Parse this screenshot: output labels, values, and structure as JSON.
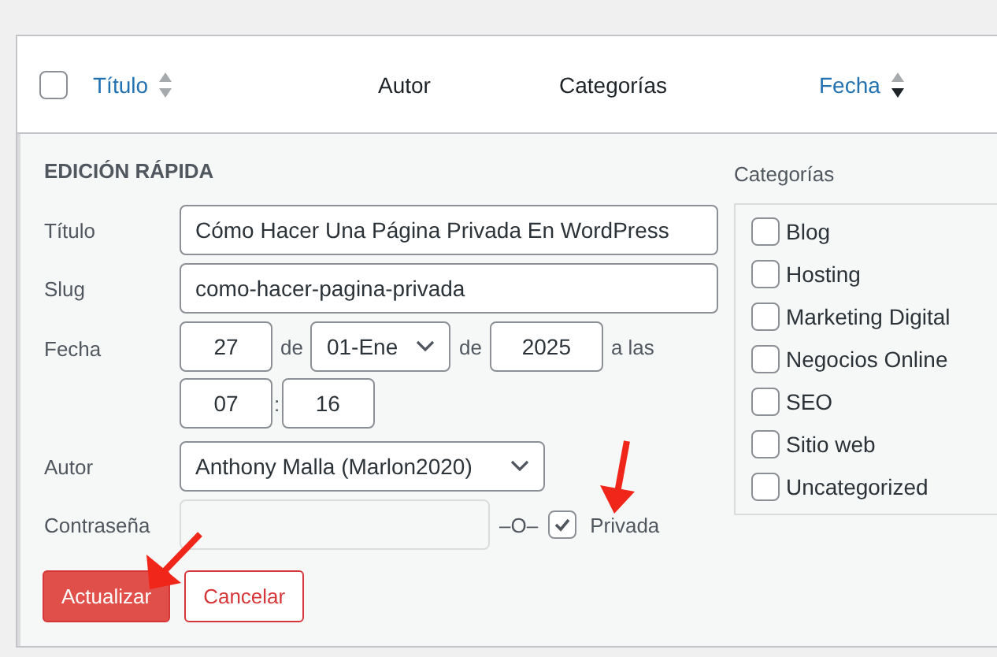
{
  "table": {
    "select_all": {
      "checked": false
    },
    "columns": [
      {
        "label": "Título",
        "kind": "sortable",
        "sorted_descending": false
      },
      {
        "label": "Autor",
        "kind": "plain"
      },
      {
        "label": "Categorías",
        "kind": "plain"
      },
      {
        "label": "Fecha",
        "kind": "sortable",
        "sorted_descending": true
      }
    ]
  },
  "quick_edit": {
    "heading": "EDICIÓN RÁPIDA",
    "title": {
      "label": "Título",
      "value": "Cómo Hacer Una Página Privada En WordPress"
    },
    "slug": {
      "label": "Slug",
      "value": "como-hacer-pagina-privada"
    },
    "date": {
      "label": "Fecha",
      "day": "27",
      "sep_1": "de",
      "month": "01-Ene",
      "sep_2": "de",
      "year": "2025",
      "sep_3": "a las",
      "hour": "07",
      "time_sep": ":",
      "minute": "16"
    },
    "author": {
      "label": "Autor",
      "value": "Anthony Malla (Marlon2020)"
    },
    "password": {
      "label": "Contraseña",
      "or_text": "–O–"
    },
    "private": {
      "label": "Privada",
      "checked": true
    },
    "buttons": [
      {
        "label": "Actualizar",
        "kind": "primary"
      },
      {
        "label": "Cancelar",
        "kind": "secondary"
      }
    ]
  },
  "categories": {
    "label": "Categorías",
    "items": [
      {
        "label": "Blog",
        "checked": false
      },
      {
        "label": "Hosting",
        "checked": false
      },
      {
        "label": "Marketing Digital",
        "checked": false
      },
      {
        "label": "Negocios Online",
        "checked": false
      },
      {
        "label": "SEO",
        "checked": false
      },
      {
        "label": "Sitio web",
        "checked": false
      },
      {
        "label": "Uncategorized",
        "checked": false
      }
    ]
  }
}
